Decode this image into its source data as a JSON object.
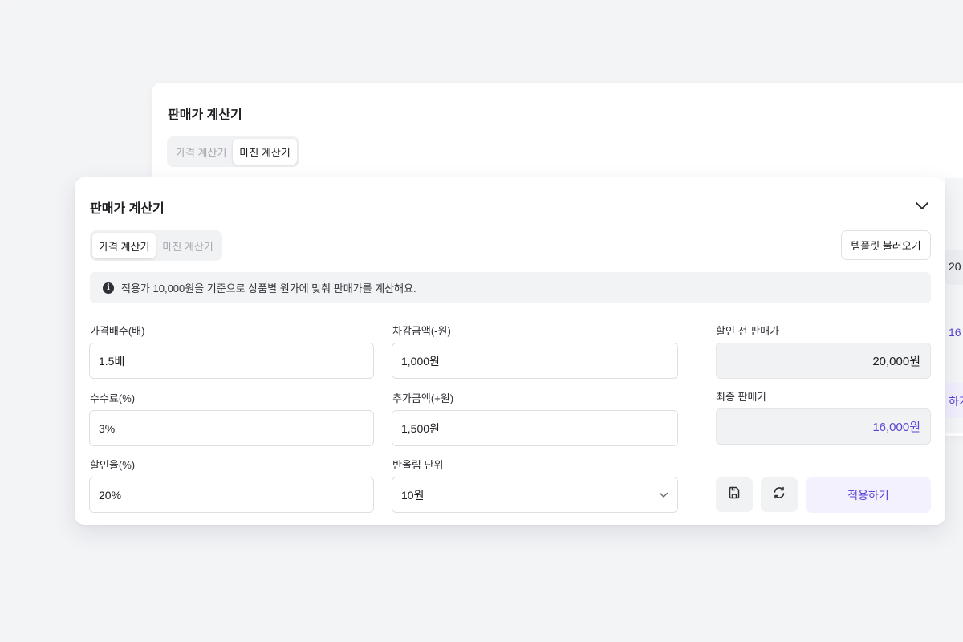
{
  "back_panel": {
    "title": "판매가 계산기",
    "tabs": [
      {
        "label": "가격 계산기",
        "active": false
      },
      {
        "label": "마진 계산기",
        "active": true
      }
    ],
    "strip": {
      "value_1": "20",
      "value_2": "16",
      "button_fragment": "하기"
    }
  },
  "card": {
    "title": "판매가 계산기",
    "tabs": [
      {
        "label": "가격 계산기",
        "active": true
      },
      {
        "label": "마진 계산기",
        "active": false
      }
    ],
    "template_button": "템플릿 불러오기",
    "info": "적용가 10,000원을 기준으로 상품별 원가에 맞춰 판매가를 계산해요.",
    "fields": {
      "multiplier": {
        "label": "가격배수(배)",
        "value": "1.5배"
      },
      "fee": {
        "label": "수수료(%)",
        "value": "3%"
      },
      "discount": {
        "label": "할인율(%)",
        "value": "20%"
      },
      "deduct": {
        "label": "차감금액(-원)",
        "value": "1,000원"
      },
      "add": {
        "label": "추가금액(+원)",
        "value": "1,500원"
      },
      "rounding": {
        "label": "반올림 단위",
        "value": "10원"
      }
    },
    "results": {
      "pre_discount": {
        "label": "할인 전 판매가",
        "value": "20,000원"
      },
      "final": {
        "label": "최종 판매가",
        "value": "16,000원"
      }
    },
    "apply_button": "적용하기"
  },
  "icons": {
    "info": "info-icon",
    "collapse": "chevron-down-icon",
    "save": "save-icon",
    "reset": "refresh-icon",
    "dropdown": "chevron-down-icon"
  },
  "colors": {
    "accent": "#5a45d8",
    "accent_bg": "#f3f1fd",
    "background": "#f3f4f6"
  }
}
